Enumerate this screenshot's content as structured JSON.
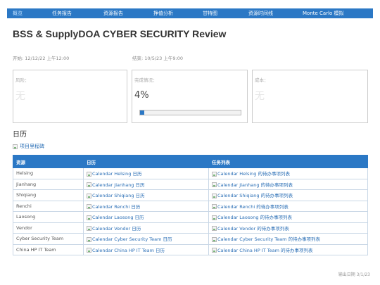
{
  "nav": {
    "tabs": [
      {
        "label": "概览",
        "active": true
      },
      {
        "label": "任务报告",
        "active": false
      },
      {
        "label": "资源报告",
        "active": false
      },
      {
        "label": "挣值分析",
        "active": false
      },
      {
        "label": "甘特图",
        "active": false
      },
      {
        "label": "资源时间线",
        "active": false
      },
      {
        "label": "Monte Carlo 模拟",
        "active": false
      }
    ]
  },
  "header": {
    "title": "BSS & SupplyDOA CYBER SECURITY Review",
    "start": "开始: 12/12/22 上午12:00",
    "end": "结束: 10/5/23 上午9:00"
  },
  "cards": {
    "risk": {
      "label": "风险：",
      "value": "无"
    },
    "completion": {
      "label": "完成情况：",
      "value": "4%",
      "progress": 0.04
    },
    "cost": {
      "label": "成本：",
      "value": "无"
    }
  },
  "calendar": {
    "section_title": "日历",
    "milestone_link": "项目里程碑",
    "columns": [
      "资源",
      "日历",
      "任务列表"
    ],
    "rows": [
      {
        "resource": "Helsing",
        "calendar": "Calendar Helsing 日历",
        "tasks": "Calendar Helsing 的待办事项列表"
      },
      {
        "resource": "Jianhang",
        "calendar": "Calendar Jianhang 日历",
        "tasks": "Calendar Jianhang 的待办事项列表"
      },
      {
        "resource": "Shiqiang",
        "calendar": "Calendar Shiqiang 日历",
        "tasks": "Calendar Shiqiang 的待办事项列表"
      },
      {
        "resource": "Renchi",
        "calendar": "Calendar Renchi 日历",
        "tasks": "Calendar Renchi 的待办事项列表"
      },
      {
        "resource": "Laosong",
        "calendar": "Calendar Laosong 日历",
        "tasks": "Calendar Laosong 的待办事项列表"
      },
      {
        "resource": "Vendor",
        "calendar": "Calendar Vendor 日历",
        "tasks": "Calendar Vendor 的待办事项列表"
      },
      {
        "resource": "Cyber Security Team",
        "calendar": "Calendar Cyber Security Team 日历",
        "tasks": "Calendar Cyber Security Team 的待办事项列表"
      },
      {
        "resource": "China HP IT Team",
        "calendar": "Calendar China HP IT Team 日历",
        "tasks": "Calendar China HP IT Team 的待办事项列表"
      }
    ]
  },
  "footer": {
    "export_date": "输出日期 3/1/23"
  }
}
